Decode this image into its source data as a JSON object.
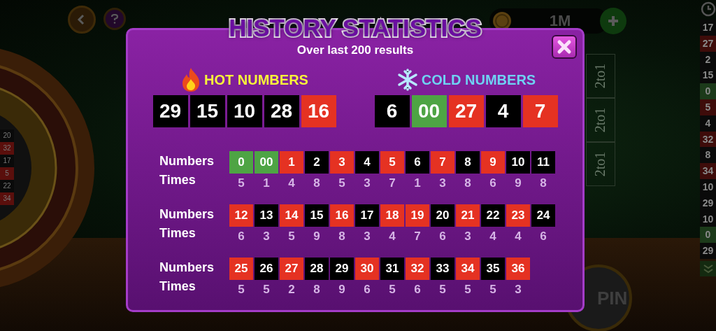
{
  "game": {
    "balance": "1M",
    "spin_label": "PIN",
    "column_bets": [
      "2to1",
      "2to1",
      "2to1"
    ],
    "wheel_numbers": [
      {
        "number": "20",
        "color": "#0a0a0a"
      },
      {
        "number": "32",
        "color": "#5a0f0c"
      },
      {
        "number": "17",
        "color": "#0a0a0a"
      },
      {
        "number": "5",
        "color": "#5a0f0c"
      },
      {
        "number": "22",
        "color": "#0a0a0a"
      },
      {
        "number": "34",
        "color": "#5a0f0c"
      }
    ],
    "history": [
      {
        "number": "17",
        "color": "#0a0a0a"
      },
      {
        "number": "27",
        "color": "#3e0c0a"
      },
      {
        "number": "2",
        "color": "#0a0a0a"
      },
      {
        "number": "15",
        "color": "#0a0a0a"
      },
      {
        "number": "0",
        "color": "#1c3a1a"
      },
      {
        "number": "5",
        "color": "#3e0c0a"
      },
      {
        "number": "4",
        "color": "#0a0a0a"
      },
      {
        "number": "32",
        "color": "#3e0c0a"
      },
      {
        "number": "8",
        "color": "#0a0a0a"
      },
      {
        "number": "34",
        "color": "#3e0c0a"
      },
      {
        "number": "10",
        "color": "#0a0a0a"
      },
      {
        "number": "29",
        "color": "#0a0a0a"
      },
      {
        "number": "10",
        "color": "#0a0a0a"
      },
      {
        "number": "0",
        "color": "#1c3a1a"
      },
      {
        "number": "29",
        "color": "#0a0a0a"
      }
    ]
  },
  "dialog": {
    "title": "HISTORY STATISTICS",
    "subtitle": "Over last 200 results",
    "hot": {
      "label": "HOT NUMBERS",
      "numbers": [
        {
          "number": "29",
          "color": "#000000"
        },
        {
          "number": "15",
          "color": "#000000"
        },
        {
          "number": "10",
          "color": "#000000"
        },
        {
          "number": "28",
          "color": "#000000"
        },
        {
          "number": "16",
          "color": "#e53222"
        }
      ]
    },
    "cold": {
      "label": "COLD NUMBERS",
      "numbers": [
        {
          "number": "6",
          "color": "#000000"
        },
        {
          "number": "00",
          "color": "#4ea444"
        },
        {
          "number": "27",
          "color": "#e53222"
        },
        {
          "number": "4",
          "color": "#000000"
        },
        {
          "number": "7",
          "color": "#e53222"
        }
      ]
    },
    "groups": [
      {
        "numbers_label": "Numbers",
        "times_label": "Times",
        "cells": [
          {
            "number": "0",
            "times": "5",
            "color": "#4ea444"
          },
          {
            "number": "00",
            "times": "1",
            "color": "#4ea444"
          },
          {
            "number": "1",
            "times": "4",
            "color": "#e53222"
          },
          {
            "number": "2",
            "times": "8",
            "color": "#000000"
          },
          {
            "number": "3",
            "times": "5",
            "color": "#e53222"
          },
          {
            "number": "4",
            "times": "3",
            "color": "#000000"
          },
          {
            "number": "5",
            "times": "7",
            "color": "#e53222"
          },
          {
            "number": "6",
            "times": "1",
            "color": "#000000"
          },
          {
            "number": "7",
            "times": "3",
            "color": "#e53222"
          },
          {
            "number": "8",
            "times": "8",
            "color": "#000000"
          },
          {
            "number": "9",
            "times": "6",
            "color": "#e53222"
          },
          {
            "number": "10",
            "times": "9",
            "color": "#000000"
          },
          {
            "number": "11",
            "times": "8",
            "color": "#000000"
          }
        ]
      },
      {
        "numbers_label": "Numbers",
        "times_label": "Times",
        "cells": [
          {
            "number": "12",
            "times": "6",
            "color": "#e53222"
          },
          {
            "number": "13",
            "times": "3",
            "color": "#000000"
          },
          {
            "number": "14",
            "times": "5",
            "color": "#e53222"
          },
          {
            "number": "15",
            "times": "9",
            "color": "#000000"
          },
          {
            "number": "16",
            "times": "8",
            "color": "#e53222"
          },
          {
            "number": "17",
            "times": "3",
            "color": "#000000"
          },
          {
            "number": "18",
            "times": "4",
            "color": "#e53222"
          },
          {
            "number": "19",
            "times": "7",
            "color": "#e53222"
          },
          {
            "number": "20",
            "times": "6",
            "color": "#000000"
          },
          {
            "number": "21",
            "times": "3",
            "color": "#e53222"
          },
          {
            "number": "22",
            "times": "4",
            "color": "#000000"
          },
          {
            "number": "23",
            "times": "4",
            "color": "#e53222"
          },
          {
            "number": "24",
            "times": "6",
            "color": "#000000"
          }
        ]
      },
      {
        "numbers_label": "Numbers",
        "times_label": "Times",
        "cells": [
          {
            "number": "25",
            "times": "5",
            "color": "#e53222"
          },
          {
            "number": "26",
            "times": "5",
            "color": "#000000"
          },
          {
            "number": "27",
            "times": "2",
            "color": "#e53222"
          },
          {
            "number": "28",
            "times": "8",
            "color": "#000000"
          },
          {
            "number": "29",
            "times": "9",
            "color": "#000000"
          },
          {
            "number": "30",
            "times": "6",
            "color": "#e53222"
          },
          {
            "number": "31",
            "times": "5",
            "color": "#000000"
          },
          {
            "number": "32",
            "times": "6",
            "color": "#e53222"
          },
          {
            "number": "33",
            "times": "5",
            "color": "#000000"
          },
          {
            "number": "34",
            "times": "5",
            "color": "#e53222"
          },
          {
            "number": "35",
            "times": "5",
            "color": "#000000"
          },
          {
            "number": "36",
            "times": "3",
            "color": "#e53222"
          }
        ]
      }
    ]
  }
}
